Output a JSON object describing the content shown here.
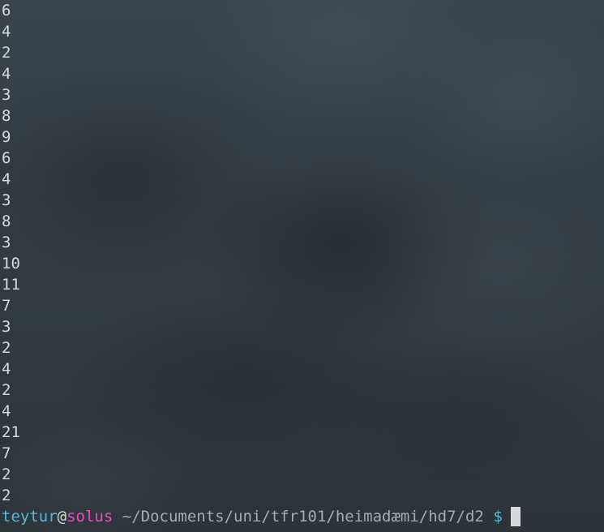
{
  "terminal": {
    "output_lines": [
      "6",
      "4",
      "2",
      "4",
      "3",
      "8",
      "9",
      "6",
      "4",
      "3",
      "8",
      "3",
      "10",
      "11",
      "7",
      "3",
      "2",
      "4",
      "2",
      "4",
      "21",
      "7",
      "2",
      "2"
    ],
    "prompt": {
      "user": "teytur",
      "at": "@",
      "host": "solus",
      "path": "~/Documents/uni/tfr101/heimadæmi/hd7/d2",
      "symbol": "$"
    }
  },
  "colors": {
    "user": "#55b8d8",
    "host": "#e84cc4",
    "text": "#d7dadc",
    "path": "#a6acb0"
  }
}
